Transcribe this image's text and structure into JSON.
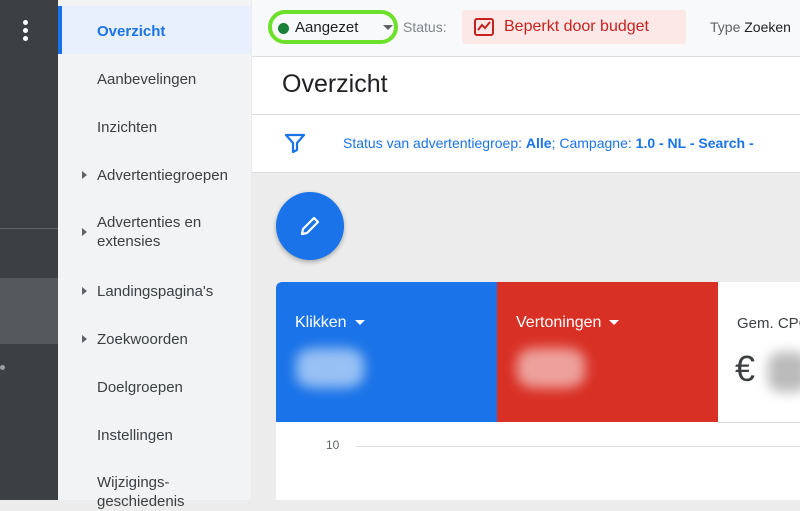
{
  "nav": {
    "items": [
      {
        "label": "Overzicht",
        "active": true,
        "expandable": false
      },
      {
        "label": "Aanbevelingen",
        "expandable": false
      },
      {
        "label": "Inzichten",
        "expandable": false
      },
      {
        "label": "Advertentiegroepen",
        "expandable": true
      },
      {
        "label": "Advertenties en extensies",
        "expandable": true
      },
      {
        "label": "Landingspagina's",
        "expandable": true
      },
      {
        "label": "Zoekwoorden",
        "expandable": true
      },
      {
        "label": "Doelgroepen",
        "expandable": false
      },
      {
        "label": "Instellingen",
        "expandable": false
      },
      {
        "label": "Wijzigings-geschiedenis",
        "expandable": false
      }
    ]
  },
  "topbar": {
    "campaign_state": "Aangezet",
    "status_label": "Status:",
    "status_value": "Beperkt door budget",
    "type_label": "Type",
    "type_value": "Zoeken"
  },
  "page": {
    "title": "Overzicht"
  },
  "filter": {
    "prefix1": "Status van advertentiegroep:",
    "value1": "Alle",
    "prefix2": "; Campagne:",
    "value2": "1.0 - NL - Search -"
  },
  "metrics": [
    {
      "label": "Klikken",
      "color": "#1a73e8"
    },
    {
      "label": "Vertoningen",
      "color": "#d93025"
    },
    {
      "label": "Gem. CPC",
      "currency": "€"
    }
  ],
  "chart": {
    "y_tick": "10"
  },
  "icons": {
    "more": "more-vert-icon",
    "filter": "filter-icon",
    "edit": "pencil-icon",
    "budget": "trend-chart-icon"
  },
  "colors": {
    "accent": "#1a73e8",
    "enabled": "#188038",
    "error": "#c5221f",
    "highlight": "#6ce02a"
  }
}
